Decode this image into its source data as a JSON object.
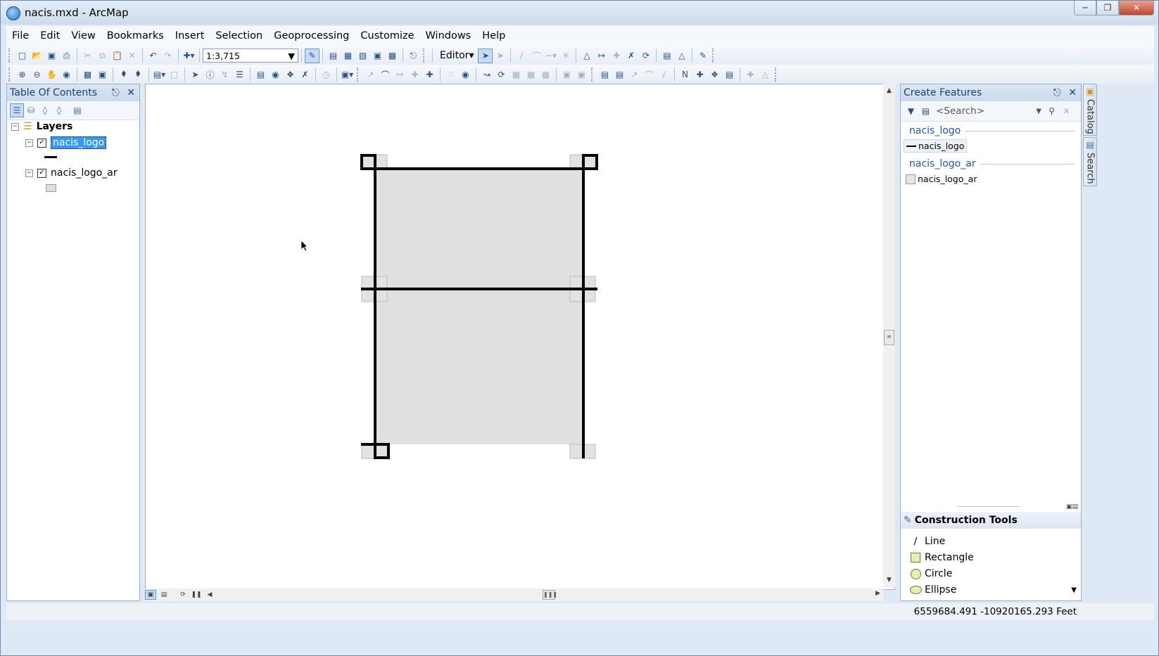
{
  "window": {
    "title": "nacis.mxd - ArcMap",
    "min_icon": "minimize-icon",
    "max_icon": "maximize-icon",
    "close_icon": "close-icon"
  },
  "menu": [
    "File",
    "Edit",
    "View",
    "Bookmarks",
    "Insert",
    "Selection",
    "Geoprocessing",
    "Customize",
    "Windows",
    "Help"
  ],
  "standard_toolbar": {
    "scale": "1:3,715",
    "editor_label": "Editor"
  },
  "toc": {
    "title": "Table Of Contents",
    "root": "Layers",
    "layers": [
      {
        "name": "nacis_logo",
        "checked": true,
        "symbol": "line",
        "selected": true
      },
      {
        "name": "nacis_logo_ar",
        "checked": true,
        "symbol": "polygon",
        "selected": false
      }
    ]
  },
  "create_features": {
    "title": "Create Features",
    "search_placeholder": "<Search>",
    "groups": [
      {
        "name": "nacis_logo",
        "template": "nacis_logo",
        "symbol": "line"
      },
      {
        "name": "nacis_logo_ar",
        "template": "nacis_logo_ar",
        "symbol": "polygon"
      }
    ]
  },
  "construction_tools": {
    "title": "Construction Tools",
    "tools": [
      {
        "label": "Line",
        "icon": "line-tool-icon"
      },
      {
        "label": "Rectangle",
        "icon": "rectangle-tool-icon"
      },
      {
        "label": "Circle",
        "icon": "circle-tool-icon"
      },
      {
        "label": "Ellipse",
        "icon": "ellipse-tool-icon"
      }
    ]
  },
  "side_tabs": [
    "Catalog",
    "Search"
  ],
  "status": {
    "coordinates": "6559684.491  -10920165.293 Feet"
  },
  "colors": {
    "selection": "#3399ff",
    "polygon_fill": "#e0e0e0",
    "line": "#000000",
    "panel_border": "#9eb0c8",
    "template_group": "#1f57b4"
  }
}
